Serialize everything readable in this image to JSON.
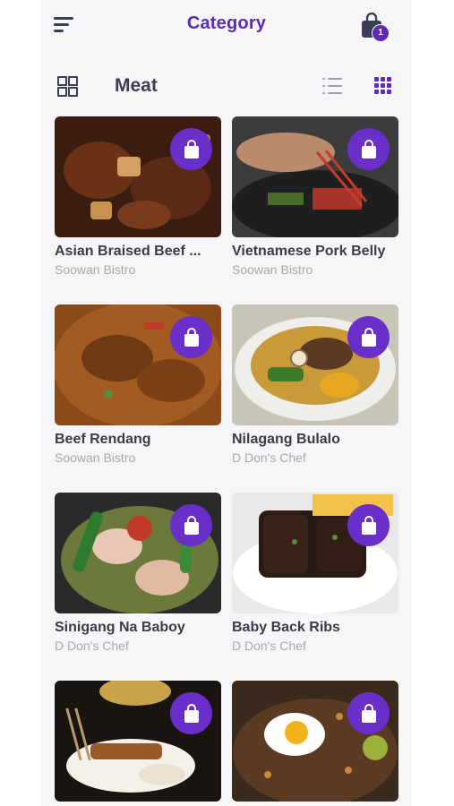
{
  "header": {
    "title": "Category",
    "cart_count": "1"
  },
  "category": {
    "name": "Meat"
  },
  "icons": {
    "menu": "menu-icon",
    "cart": "shopping-bag-icon",
    "category": "grid-category-icon",
    "list_view": "list-view-icon",
    "grid_view": "grid-view-icon",
    "add_to_bag": "shopping-bag-icon"
  },
  "colors": {
    "accent": "#5b2bb5",
    "text_dark": "#3a3f55",
    "text_muted": "#a7a7ae"
  },
  "products": [
    {
      "name": "Asian Braised Beef ...",
      "shop": "Soowan Bistro"
    },
    {
      "name": "Vietnamese Pork Belly",
      "shop": "Soowan Bistro"
    },
    {
      "name": "Beef Rendang",
      "shop": "Soowan Bistro"
    },
    {
      "name": "Nilagang Bulalo",
      "shop": "D Don's Chef"
    },
    {
      "name": "Sinigang  Na Baboy",
      "shop": "D Don's Chef"
    },
    {
      "name": "Baby Back Ribs",
      "shop": "D Don's Chef"
    },
    {
      "name": "",
      "shop": ""
    },
    {
      "name": "",
      "shop": ""
    }
  ]
}
